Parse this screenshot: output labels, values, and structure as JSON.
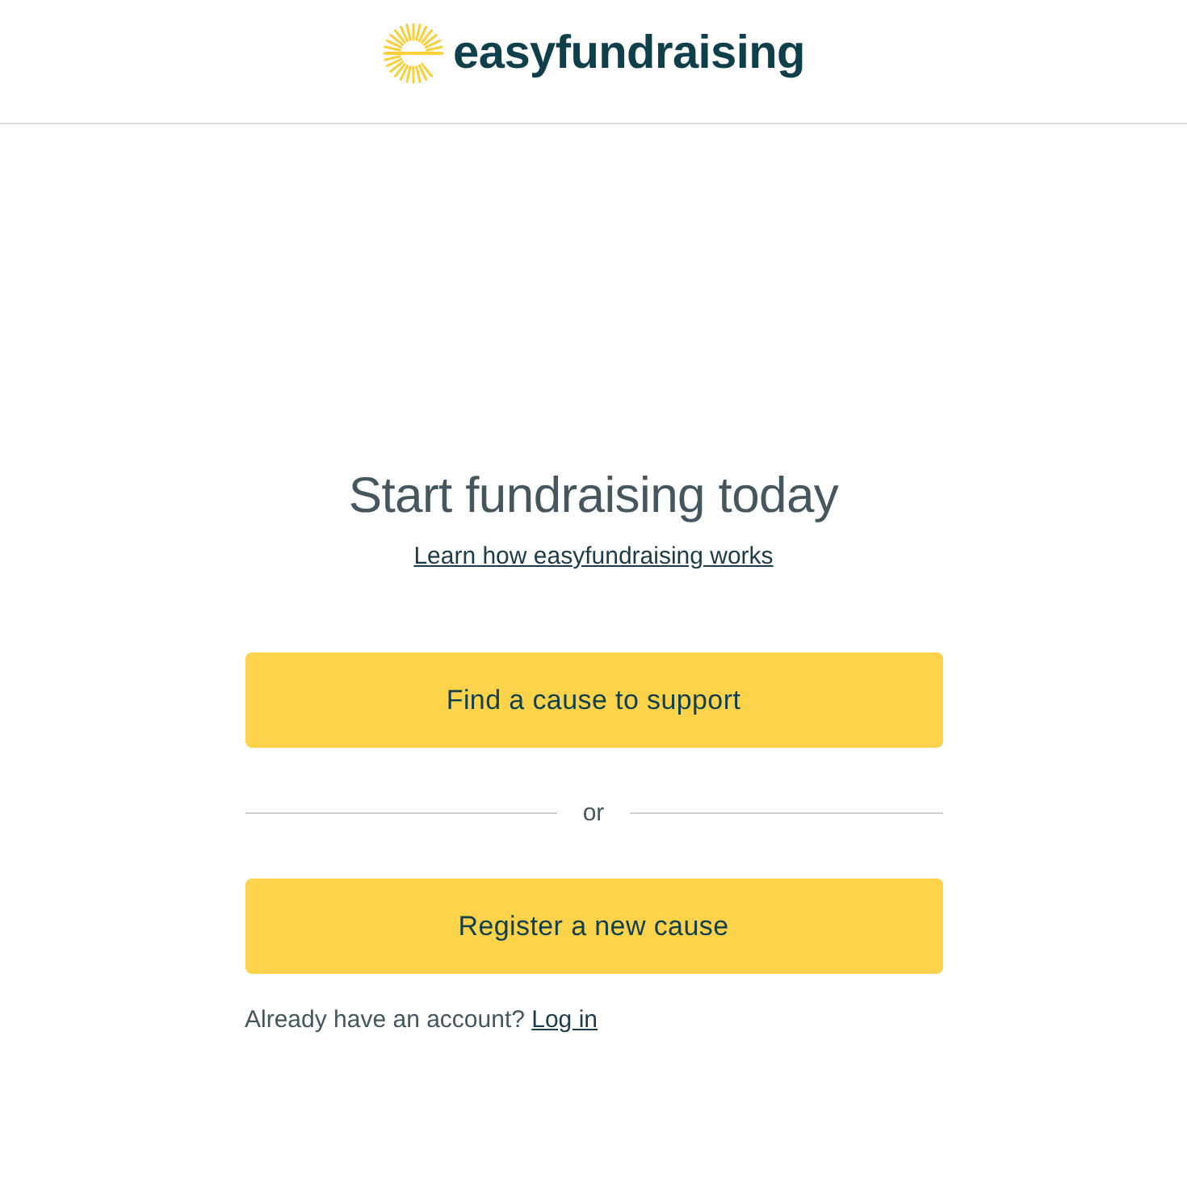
{
  "header": {
    "logo_text": "easyfundraising"
  },
  "hero": {
    "title": "Start fundraising today",
    "link": "Learn how easyfundraising works"
  },
  "actions": [
    {
      "kind": "button",
      "label": "Find a cause to support"
    },
    {
      "kind": "divider",
      "label": "or"
    },
    {
      "kind": "button",
      "label": "Register a new cause"
    }
  ],
  "login": {
    "prompt": "Already have an account?",
    "link": "Log in"
  }
}
